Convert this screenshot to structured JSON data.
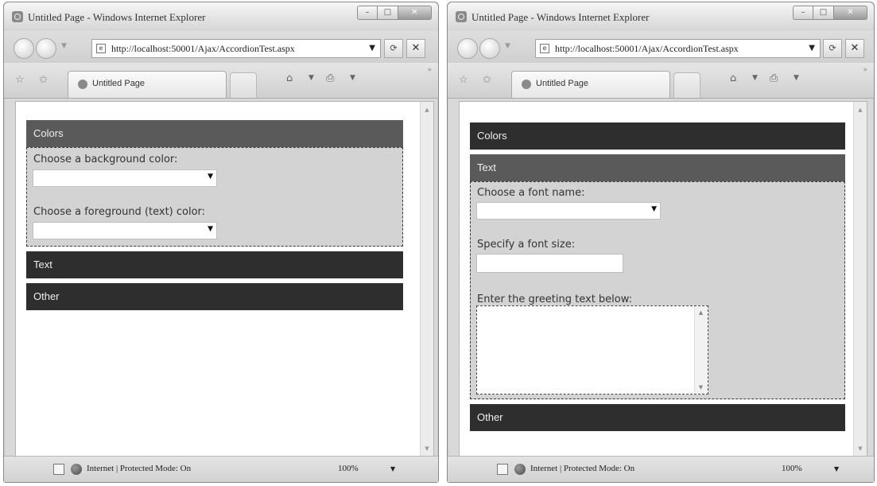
{
  "windows": {
    "left": {
      "title": "Untitled Page - Windows Internet Explorer",
      "url": "http://localhost:50001/Ajax/AccordionTest.aspx",
      "tab_label": "Untitled Page",
      "status": "Internet | Protected Mode: On",
      "zoom": "100%",
      "panes": [
        {
          "header": "Colors",
          "expanded": true
        },
        {
          "header": "Text",
          "expanded": false
        },
        {
          "header": "Other",
          "expanded": false
        }
      ],
      "colors_panel": {
        "background_label": "Choose a background color:",
        "background_value": "",
        "foreground_label": "Choose a foreground (text) color:",
        "foreground_value": ""
      }
    },
    "right": {
      "title": "Untitled Page - Windows Internet Explorer",
      "url": "http://localhost:50001/Ajax/AccordionTest.aspx",
      "tab_label": "Untitled Page",
      "status": "Internet | Protected Mode: On",
      "zoom": "100%",
      "panes": [
        {
          "header": "Colors",
          "expanded": false
        },
        {
          "header": "Text",
          "expanded": true
        },
        {
          "header": "Other",
          "expanded": false
        }
      ],
      "text_panel": {
        "font_name_label": "Choose a font name:",
        "font_name_value": "",
        "font_size_label": "Specify a font size:",
        "font_size_value": "",
        "greeting_label": "Enter the greeting text below:",
        "greeting_value": ""
      }
    }
  },
  "icons": {
    "back": "back-arrow-icon",
    "forward": "forward-arrow-icon",
    "refresh": "refresh-icon",
    "stop": "close-icon",
    "favorites": "star-icon",
    "add_favorite": "add-favorite-icon",
    "home": "home-icon",
    "print": "printer-icon",
    "zone": "globe-icon"
  },
  "colors": {
    "accordion_header": "#2e2e2e",
    "accordion_header_active": "#5a5a5a",
    "accordion_panel": "#d3d3d3"
  }
}
